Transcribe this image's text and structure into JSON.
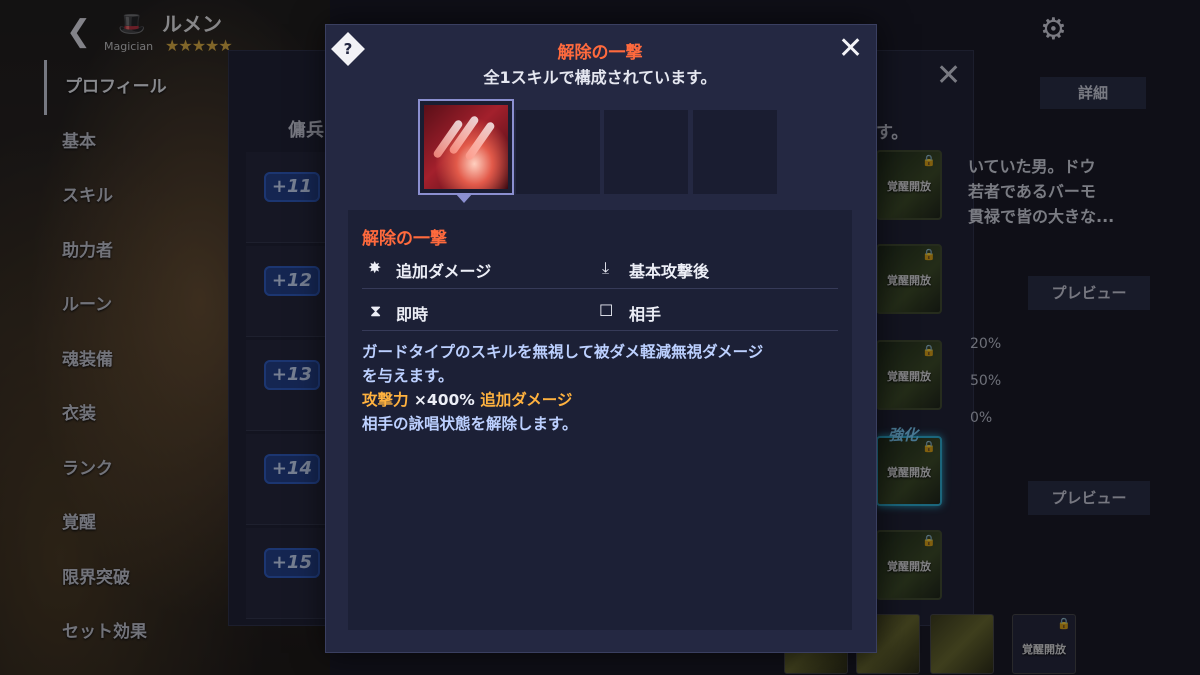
{
  "header": {
    "hero_name": "ルメン",
    "hero_class": "Magician",
    "stars": "★★★★★",
    "icons": [
      "chevron-left-icon",
      "wizard-hat-icon",
      "settings-gear-icon"
    ]
  },
  "sidebar": {
    "items": [
      {
        "label": "プロフィール",
        "active": true
      },
      {
        "label": "基本"
      },
      {
        "label": "スキル"
      },
      {
        "label": "助力者"
      },
      {
        "label": "ルーン"
      },
      {
        "label": "魂装備"
      },
      {
        "label": "衣装"
      },
      {
        "label": "ランク"
      },
      {
        "label": "覚醒"
      },
      {
        "label": "限界突破"
      },
      {
        "label": "セット効果"
      }
    ]
  },
  "background_panel": {
    "title_left": "傭兵",
    "title_right": "す。",
    "levels": [
      "+11",
      "+12",
      "+13",
      "+14",
      "+15"
    ],
    "awaken_label": "覚醒開放",
    "enhance_label": "強化",
    "detail_tab": "詳細",
    "preview_label": "プレビュー",
    "story_lines": [
      "いていた男。ドウ",
      "若者であるバーモ",
      "貫禄で皆の大きな..."
    ],
    "percentages": [
      "20%",
      "50%",
      "0%"
    ]
  },
  "modal": {
    "help_icon": "?",
    "title": "解除の一撃",
    "subtitle": "全1スキルで構成されています。",
    "skill": {
      "name": "解除の一撃",
      "attributes": [
        {
          "icon": "extra-damage-icon",
          "label": "追加ダメージ"
        },
        {
          "icon": "after-basic-attack-icon",
          "label": "基本攻撃後"
        },
        {
          "icon": "hourglass-icon",
          "label": "即時"
        },
        {
          "icon": "target-enemy-icon",
          "label": "相手"
        }
      ],
      "description_line1": "ガードタイプのスキルを無視して被ダメ軽減無視ダメージ",
      "description_line2": "を与えます。",
      "scaling_stat": "攻撃力",
      "scaling_value": "×400%",
      "scaling_type": "追加ダメージ",
      "description_line4": "相手の詠唱状態を解除します。"
    }
  },
  "colors": {
    "accent_orange": "#ff6a3d",
    "scaling_orange": "#ffb23f",
    "description_blue": "#bcd0ff",
    "modal_bg": "#242842"
  }
}
